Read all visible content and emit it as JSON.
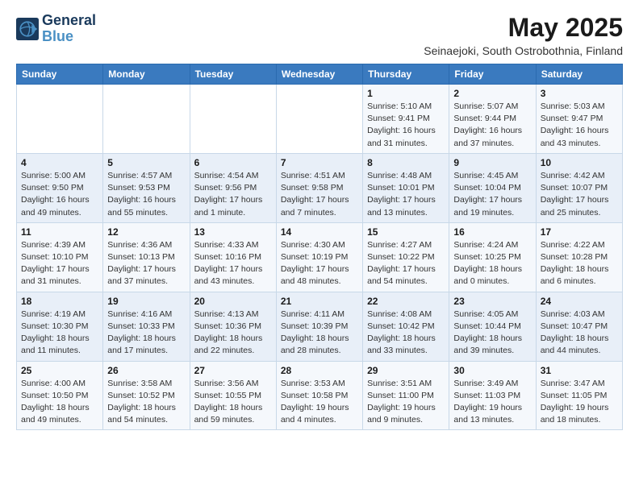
{
  "logo": {
    "line1": "General",
    "line2": "Blue"
  },
  "title": "May 2025",
  "subtitle": "Seinaejoki, South Ostrobothnia, Finland",
  "weekdays": [
    "Sunday",
    "Monday",
    "Tuesday",
    "Wednesday",
    "Thursday",
    "Friday",
    "Saturday"
  ],
  "weeks": [
    [
      {
        "day": "",
        "info": ""
      },
      {
        "day": "",
        "info": ""
      },
      {
        "day": "",
        "info": ""
      },
      {
        "day": "",
        "info": ""
      },
      {
        "day": "1",
        "info": "Sunrise: 5:10 AM\nSunset: 9:41 PM\nDaylight: 16 hours\nand 31 minutes."
      },
      {
        "day": "2",
        "info": "Sunrise: 5:07 AM\nSunset: 9:44 PM\nDaylight: 16 hours\nand 37 minutes."
      },
      {
        "day": "3",
        "info": "Sunrise: 5:03 AM\nSunset: 9:47 PM\nDaylight: 16 hours\nand 43 minutes."
      }
    ],
    [
      {
        "day": "4",
        "info": "Sunrise: 5:00 AM\nSunset: 9:50 PM\nDaylight: 16 hours\nand 49 minutes."
      },
      {
        "day": "5",
        "info": "Sunrise: 4:57 AM\nSunset: 9:53 PM\nDaylight: 16 hours\nand 55 minutes."
      },
      {
        "day": "6",
        "info": "Sunrise: 4:54 AM\nSunset: 9:56 PM\nDaylight: 17 hours\nand 1 minute."
      },
      {
        "day": "7",
        "info": "Sunrise: 4:51 AM\nSunset: 9:58 PM\nDaylight: 17 hours\nand 7 minutes."
      },
      {
        "day": "8",
        "info": "Sunrise: 4:48 AM\nSunset: 10:01 PM\nDaylight: 17 hours\nand 13 minutes."
      },
      {
        "day": "9",
        "info": "Sunrise: 4:45 AM\nSunset: 10:04 PM\nDaylight: 17 hours\nand 19 minutes."
      },
      {
        "day": "10",
        "info": "Sunrise: 4:42 AM\nSunset: 10:07 PM\nDaylight: 17 hours\nand 25 minutes."
      }
    ],
    [
      {
        "day": "11",
        "info": "Sunrise: 4:39 AM\nSunset: 10:10 PM\nDaylight: 17 hours\nand 31 minutes."
      },
      {
        "day": "12",
        "info": "Sunrise: 4:36 AM\nSunset: 10:13 PM\nDaylight: 17 hours\nand 37 minutes."
      },
      {
        "day": "13",
        "info": "Sunrise: 4:33 AM\nSunset: 10:16 PM\nDaylight: 17 hours\nand 43 minutes."
      },
      {
        "day": "14",
        "info": "Sunrise: 4:30 AM\nSunset: 10:19 PM\nDaylight: 17 hours\nand 48 minutes."
      },
      {
        "day": "15",
        "info": "Sunrise: 4:27 AM\nSunset: 10:22 PM\nDaylight: 17 hours\nand 54 minutes."
      },
      {
        "day": "16",
        "info": "Sunrise: 4:24 AM\nSunset: 10:25 PM\nDaylight: 18 hours\nand 0 minutes."
      },
      {
        "day": "17",
        "info": "Sunrise: 4:22 AM\nSunset: 10:28 PM\nDaylight: 18 hours\nand 6 minutes."
      }
    ],
    [
      {
        "day": "18",
        "info": "Sunrise: 4:19 AM\nSunset: 10:30 PM\nDaylight: 18 hours\nand 11 minutes."
      },
      {
        "day": "19",
        "info": "Sunrise: 4:16 AM\nSunset: 10:33 PM\nDaylight: 18 hours\nand 17 minutes."
      },
      {
        "day": "20",
        "info": "Sunrise: 4:13 AM\nSunset: 10:36 PM\nDaylight: 18 hours\nand 22 minutes."
      },
      {
        "day": "21",
        "info": "Sunrise: 4:11 AM\nSunset: 10:39 PM\nDaylight: 18 hours\nand 28 minutes."
      },
      {
        "day": "22",
        "info": "Sunrise: 4:08 AM\nSunset: 10:42 PM\nDaylight: 18 hours\nand 33 minutes."
      },
      {
        "day": "23",
        "info": "Sunrise: 4:05 AM\nSunset: 10:44 PM\nDaylight: 18 hours\nand 39 minutes."
      },
      {
        "day": "24",
        "info": "Sunrise: 4:03 AM\nSunset: 10:47 PM\nDaylight: 18 hours\nand 44 minutes."
      }
    ],
    [
      {
        "day": "25",
        "info": "Sunrise: 4:00 AM\nSunset: 10:50 PM\nDaylight: 18 hours\nand 49 minutes."
      },
      {
        "day": "26",
        "info": "Sunrise: 3:58 AM\nSunset: 10:52 PM\nDaylight: 18 hours\nand 54 minutes."
      },
      {
        "day": "27",
        "info": "Sunrise: 3:56 AM\nSunset: 10:55 PM\nDaylight: 18 hours\nand 59 minutes."
      },
      {
        "day": "28",
        "info": "Sunrise: 3:53 AM\nSunset: 10:58 PM\nDaylight: 19 hours\nand 4 minutes."
      },
      {
        "day": "29",
        "info": "Sunrise: 3:51 AM\nSunset: 11:00 PM\nDaylight: 19 hours\nand 9 minutes."
      },
      {
        "day": "30",
        "info": "Sunrise: 3:49 AM\nSunset: 11:03 PM\nDaylight: 19 hours\nand 13 minutes."
      },
      {
        "day": "31",
        "info": "Sunrise: 3:47 AM\nSunset: 11:05 PM\nDaylight: 19 hours\nand 18 minutes."
      }
    ]
  ]
}
